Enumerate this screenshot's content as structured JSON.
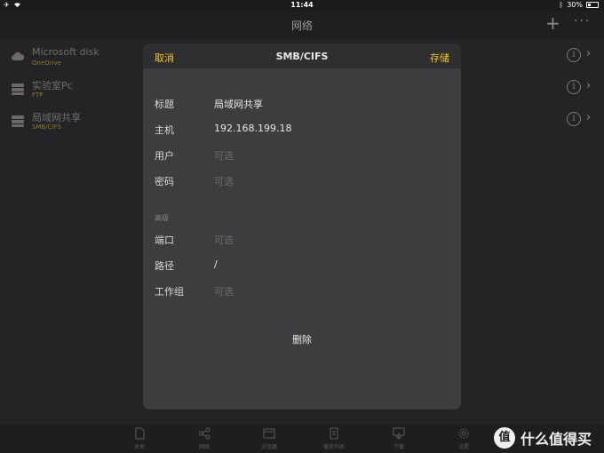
{
  "status": {
    "time": "11:44",
    "battery": "30%",
    "battery_level": 0.3
  },
  "nav": {
    "title": "网络",
    "plus": "+",
    "more": "···"
  },
  "connections": [
    {
      "name": "Microsoft disk",
      "type": "OneDrive",
      "icon": "cloud-icon"
    },
    {
      "name": "实验室Pc",
      "type": "FTP",
      "icon": "server-icon"
    },
    {
      "name": "局域网共享",
      "type": "SMB/CIFS",
      "icon": "server-icon"
    }
  ],
  "dialog": {
    "cancel": "取消",
    "title": "SMB/CIFS",
    "save": "存储",
    "fields": [
      {
        "label": "标题",
        "value": "局域网共享",
        "placeholder": ""
      },
      {
        "label": "主机",
        "value": "192.168.199.18",
        "placeholder": ""
      },
      {
        "label": "用户",
        "value": "",
        "placeholder": "可选"
      },
      {
        "label": "密码",
        "value": "",
        "placeholder": "可选"
      }
    ],
    "advanced_label": "高级",
    "advanced_fields": [
      {
        "label": "端口",
        "value": "",
        "placeholder": "可选"
      },
      {
        "label": "路径",
        "value": "/",
        "placeholder": ""
      },
      {
        "label": "工作组",
        "value": "",
        "placeholder": "可选"
      }
    ],
    "delete": "删除"
  },
  "tabs": [
    {
      "label": "本地",
      "icon": "document-icon"
    },
    {
      "label": "网络",
      "icon": "share-icon"
    },
    {
      "label": "浏览器",
      "icon": "browser-icon"
    },
    {
      "label": "播放列表",
      "icon": "playlist-icon"
    },
    {
      "label": "下载",
      "icon": "download-icon"
    },
    {
      "label": "设置",
      "icon": "gear-icon"
    }
  ],
  "watermark": {
    "logo": "值",
    "text": "什么值得买"
  },
  "colors": {
    "accent": "#f5c518",
    "background": "#232426",
    "dialog": "#3d3d3f"
  }
}
